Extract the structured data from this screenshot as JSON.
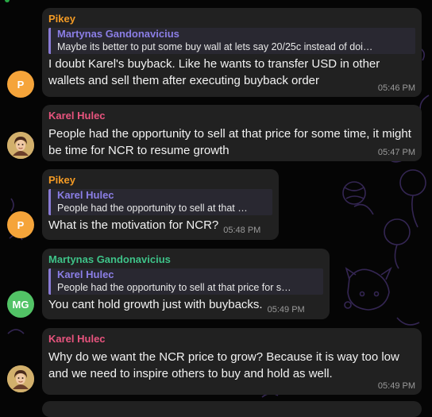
{
  "colors": {
    "background": "#050505",
    "bubble": "#212121",
    "pikey": "#f39a24",
    "karel": "#e8547e",
    "martynas": "#3ec288",
    "reply_accent": "#8b7ee6",
    "timestamp": "#9a9a9a"
  },
  "messages": [
    {
      "sender": "Pikey",
      "avatar_initials": "P",
      "avatar_color": "#f5a43a",
      "reply_to": {
        "name": "Martynas Gandonavicius",
        "text": "Maybe its better to put some buy wall at lets say 20/25c instead of doi…"
      },
      "text": "I doubt Karel's buyback. Like he wants to transfer USD in other wallets and sell them after executing buyback order",
      "time": "05:46 PM"
    },
    {
      "sender": "Karel Hulec",
      "avatar_initials": "",
      "reply_to": null,
      "text": "People had the opportunity to sell at that price for some time, it might be time for NCR to resume growth",
      "time": "05:47 PM"
    },
    {
      "sender": "Pikey",
      "avatar_initials": "P",
      "avatar_color": "#f5a43a",
      "reply_to": {
        "name": "Karel Hulec",
        "text": "People had the opportunity to sell at that …"
      },
      "text": "What is the motivation for NCR?",
      "time": "05:48 PM"
    },
    {
      "sender": "Martynas Gandonavicius",
      "avatar_initials": "MG",
      "avatar_color": "#52c366",
      "reply_to": {
        "name": "Karel Hulec",
        "text": "People had the opportunity to sell at that price for s…"
      },
      "text": "You cant hold growth just with buybacks.",
      "time": "05:49 PM"
    },
    {
      "sender": "Karel Hulec",
      "avatar_initials": "",
      "reply_to": null,
      "text": "Why do we want the NCR price to grow? Because it is way too low and we need to inspire others to buy and hold as well.",
      "time": "05:49 PM"
    }
  ]
}
